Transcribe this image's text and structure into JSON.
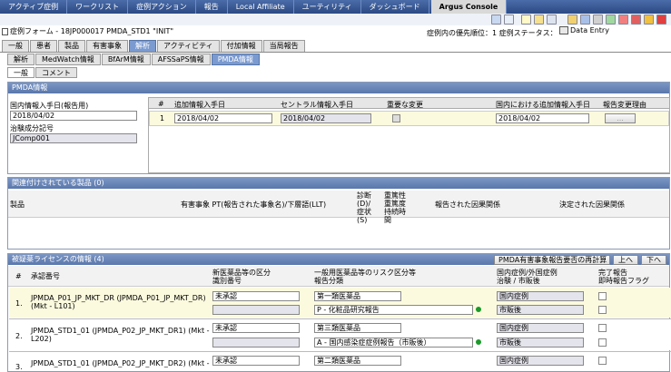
{
  "nav": {
    "tabs": [
      "アクティブ症例",
      "ワークリスト",
      "症例アクション",
      "報告",
      "Local Affiliate",
      "ユーティリティ",
      "ダッシュボード",
      "Argus Console"
    ]
  },
  "form": {
    "title": "症例フォーム - 18JP000017 PMDA_STD1 \"INIT\"",
    "priority": "症例内の優先順位：1 症例ステータス：",
    "status": "Data Entry"
  },
  "tabs": [
    "一般",
    "患者",
    "製品",
    "有害事象",
    "解析",
    "アクティビティ",
    "付加情報",
    "当局報告"
  ],
  "subtabs": [
    "解析",
    "MedWatch情報",
    "BfArM情報",
    "AFSSaPS情報",
    "PMDA情報"
  ],
  "subsubtabs": [
    "一般",
    "コメント"
  ],
  "pmda": {
    "header": "PMDA情報",
    "receipt_label": "国内情報入手日(報告用)",
    "receipt_value": "2018/04/02",
    "trial_label": "治験成分記号",
    "trial_value": "JComp001",
    "cols": [
      "#",
      "追加情報入手日",
      "セントラル情報入手日",
      "重要な変更",
      "国内における追加情報入手日",
      "報告変更理由"
    ],
    "row": {
      "num": "1",
      "add_date": "2018/04/02",
      "central_date": "2018/04/02",
      "domestic_date": "2018/04/02",
      "reason_btn": "..."
    }
  },
  "related": {
    "header": "関連付けされている製品 (0)",
    "cols": [
      "製品",
      "有害事象 PT(報告された事象名)/下層語(LLT)",
      "診断(D)/症状(S)",
      "重篤性 重篤度 持続時間",
      "報告された因果関係",
      "決定された因果関係"
    ]
  },
  "license": {
    "header": "被疑薬ライセンスの情報 (4)",
    "btn_recalc": "PMDA有害事象報告要否の再計算",
    "btn_up": "上へ",
    "btn_down": "下へ",
    "cols": {
      "num": "#",
      "approval": "承認番号",
      "newdrug": "新医薬品等の区分",
      "recno": "識別番号",
      "riskcat": "一般用医薬品等のリスク区分等",
      "reportcat": "報告分類",
      "domestic": "国内症例/外国症例",
      "market": "治験 / 市販後",
      "complete": "完了報告",
      "immediate": "即時報告フラグ"
    },
    "rows": [
      {
        "num": "1.",
        "name": "JPMDA_P01_JP_MKT_DR (JPMDA_P01_JP_MKT_DR) (Mkt - L101)",
        "newdrug": "未承認",
        "risk": "第一類医薬品",
        "report": "P - 化粧品研究報告",
        "domestic": "国内症例",
        "market": "市販後"
      },
      {
        "num": "2.",
        "name": "JPMDA_STD1_01 (JPMDA_P02_JP_MKT_DR1) (Mkt - L202)",
        "newdrug": "未承認",
        "risk": "第三類医薬品",
        "report": "A - 国内感染症症例報告（市販後）",
        "domestic": "国内症例",
        "market": "市販後"
      },
      {
        "num": "3.",
        "name": "JPMDA_STD1_01 (JPMDA_P02_JP_MKT_DR2) (Mkt -",
        "newdrug": "未承認",
        "risk": "第二類医薬品",
        "report": "",
        "domestic": "国内症例",
        "market": ""
      }
    ]
  },
  "colors": {
    "nav": "#2c4a84",
    "panel_header": "#5a77ac",
    "row_highlight": "#fcfade",
    "active_tab": "#7a9ad0",
    "status_dot": "#1a9a2a"
  }
}
